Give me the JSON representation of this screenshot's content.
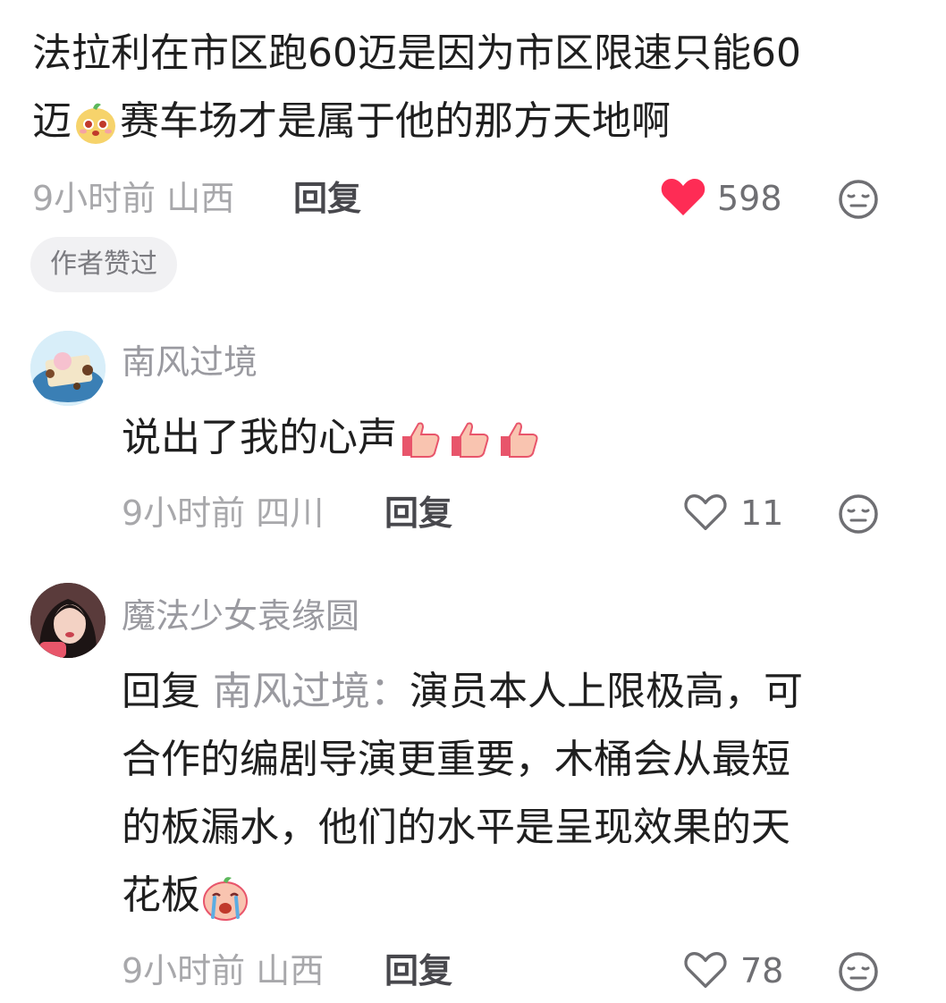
{
  "comments": [
    {
      "text_part1": "法拉利在市区跑60迈是因为市区限速只能60",
      "text_part2_a": "迈",
      "text_part2_b": "赛车场才是属于他的那方天地啊",
      "emoji": "cute-face-emoji",
      "time": "9小时前",
      "location": "山西",
      "reply_label": "回复",
      "likes": "598",
      "liked": true,
      "badge": "作者赞过"
    },
    {
      "username": "南风过境",
      "text": "说出了我的心声",
      "emojis": [
        "thumbs-up-emoji",
        "thumbs-up-emoji",
        "thumbs-up-emoji"
      ],
      "time": "9小时前",
      "location": "四川",
      "reply_label": "回复",
      "likes": "11",
      "liked": false
    },
    {
      "username": "魔法少女袁缘圆",
      "reply_prefix": "回复",
      "reply_to": "南风过境：",
      "line1": "演员本人上限极高，可",
      "line2": "合作的编剧导演更重要，木桶会从最短",
      "line3": "的板漏水，他们的水平是呈现效果的天",
      "line4": "花板",
      "emoji": "crying-face-emoji",
      "time": "9小时前",
      "location": "山西",
      "reply_label": "回复",
      "likes": "78",
      "liked": false
    }
  ],
  "colors": {
    "like_red": "#fe2c55",
    "text": "#1f1f1f",
    "muted": "#a8a8ab"
  }
}
